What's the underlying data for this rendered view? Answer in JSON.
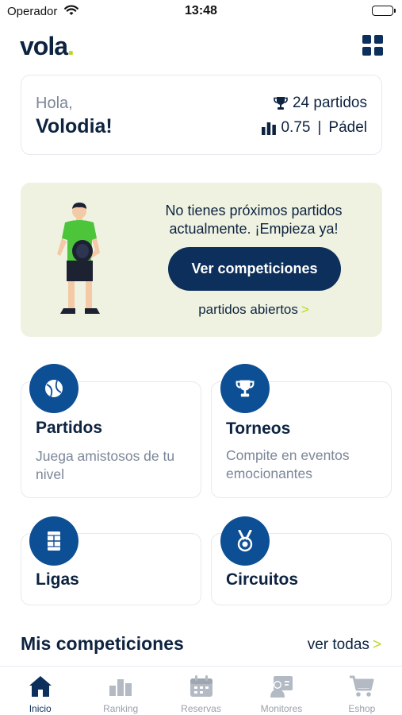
{
  "status_bar": {
    "carrier": "Operador",
    "time": "13:48"
  },
  "header": {
    "logo": "vola",
    "logo_dot": "."
  },
  "greeting": {
    "hello": "Hola,",
    "name": "Volodia!",
    "matches": "24 partidos",
    "level": "0.75",
    "separator": "|",
    "sport": "Pádel"
  },
  "promo": {
    "message": "No tienes próximos partidos actualmente. ¡Empieza ya!",
    "cta_label": "Ver competiciones",
    "link_label": "partidos abiertos",
    "chevron": ">"
  },
  "tiles": [
    {
      "title": "Partidos",
      "desc": "Juega amistosos de tu nivel",
      "icon": "ball-icon"
    },
    {
      "title": "Torneos",
      "desc": "Compite en eventos emocionantes",
      "icon": "trophy-icon"
    },
    {
      "title": "Ligas",
      "icon": "court-icon"
    },
    {
      "title": "Circuitos",
      "icon": "medal-icon"
    }
  ],
  "section": {
    "title": "Mis competiciones",
    "link": "ver todas",
    "chevron": ">"
  },
  "tabs": [
    {
      "label": "Inicio",
      "icon": "home-icon",
      "active": true
    },
    {
      "label": "Ranking",
      "icon": "ranking-icon"
    },
    {
      "label": "Reservas",
      "icon": "calendar-icon"
    },
    {
      "label": "Monitores",
      "icon": "coach-icon"
    },
    {
      "label": "Eshop",
      "icon": "cart-icon"
    }
  ],
  "colors": {
    "primary": "#0d2f5b",
    "accent": "#b9d81c",
    "badge": "#0d4f95",
    "promo_bg": "#eff2e1"
  }
}
